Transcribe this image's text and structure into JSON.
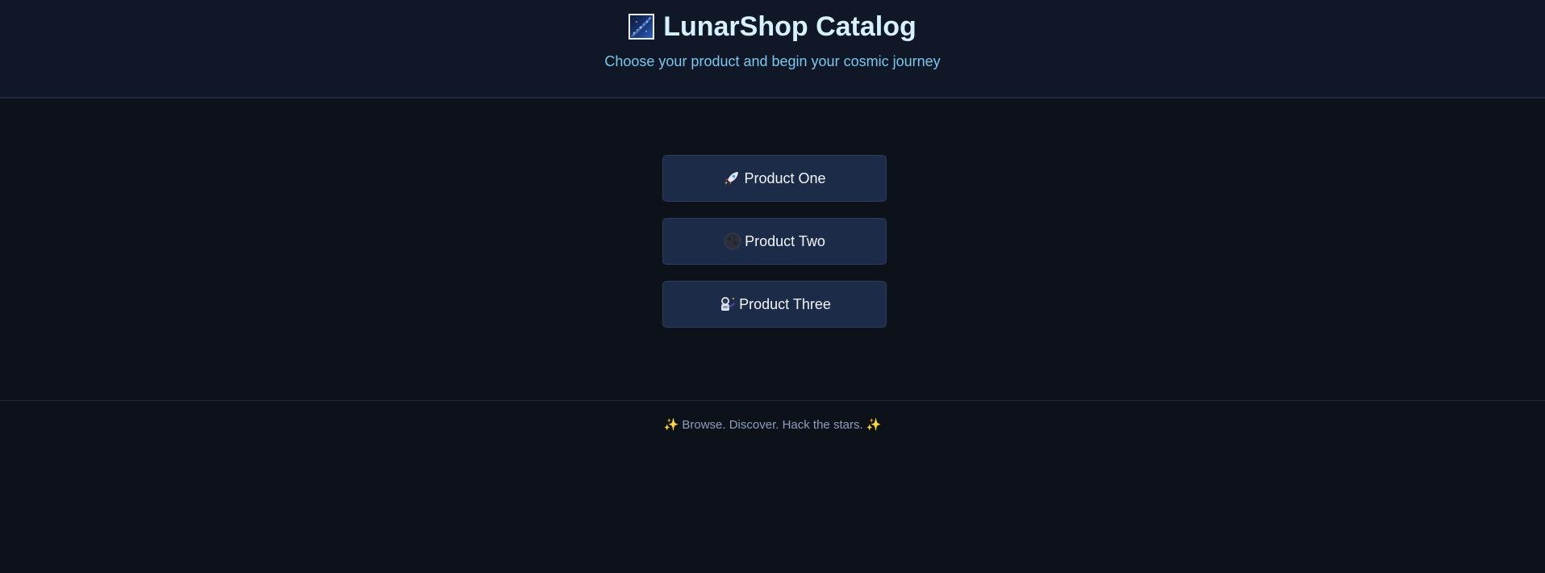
{
  "header": {
    "title": "LunarShop Catalog",
    "subtitle": "Choose your product and begin your cosmic journey",
    "logo_icon": "milky-way-icon"
  },
  "products": [
    {
      "label": "Product One",
      "icon": "rocket-icon"
    },
    {
      "label": "Product Two",
      "icon": "new-moon-icon"
    },
    {
      "label": "Product Three",
      "icon": "astronaut-icon"
    }
  ],
  "footer": {
    "text": "Browse. Discover. Hack the stars.",
    "left_icon": "sparkles-icon",
    "right_icon": "sparkles-icon"
  },
  "colors": {
    "page_bg": "#0d111a",
    "header_bg": "#101828",
    "button_bg": "#1b2b48",
    "title": "#d6f1ff",
    "subtitle": "#7cc6ec",
    "footer_text": "#8aa0bd"
  }
}
